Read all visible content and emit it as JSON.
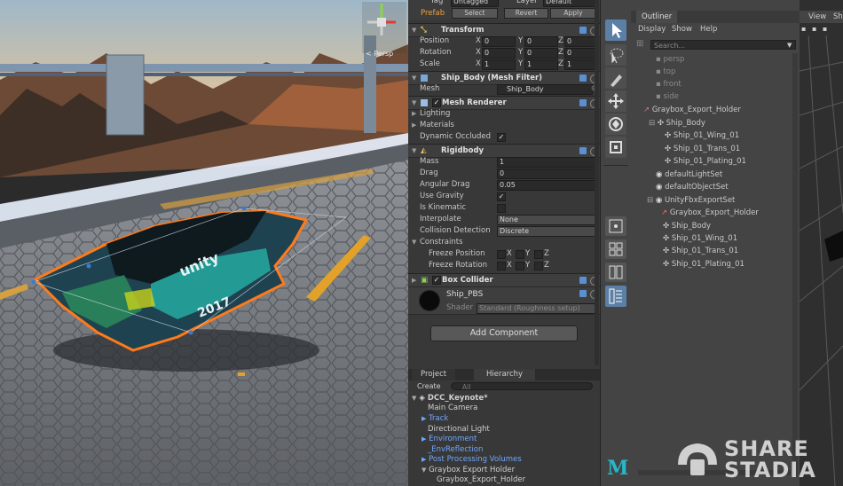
{
  "inspector": {
    "top": {
      "tag_label": "Tag",
      "tag_value": "Untagged",
      "layer_label": "Layer",
      "layer_value": "Default",
      "prefab_label": "Prefab",
      "select": "Select",
      "revert": "Revert",
      "apply": "Apply"
    },
    "transform": {
      "title": "Transform",
      "position": "Position",
      "rotation": "Rotation",
      "scale": "Scale",
      "x": "X",
      "y": "Y",
      "z": "Z",
      "pos": [
        "0",
        "0",
        "0"
      ],
      "rot": [
        "0",
        "0",
        "0"
      ],
      "scl": [
        "1",
        "1",
        "1"
      ]
    },
    "mesh_filter": {
      "title": "Ship_Body (Mesh Filter)",
      "mesh_label": "Mesh",
      "mesh_value": "Ship_Body"
    },
    "mesh_renderer": {
      "title": "Mesh Renderer",
      "lighting": "Lighting",
      "materials": "Materials",
      "dynamic_occluded": "Dynamic Occluded",
      "dynamic_occluded_check": "✓"
    },
    "rigidbody": {
      "title": "Rigidbody",
      "mass_label": "Mass",
      "mass": "1",
      "drag_label": "Drag",
      "drag": "0",
      "angular_drag_label": "Angular Drag",
      "angular_drag": "0.05",
      "use_gravity": "Use Gravity",
      "use_gravity_check": "✓",
      "is_kinematic": "Is Kinematic",
      "interpolate_label": "Interpolate",
      "interpolate": "None",
      "collision_label": "Collision Detection",
      "collision": "Discrete",
      "constraints": "Constraints",
      "freeze_position": "Freeze Position",
      "freeze_rotation": "Freeze Rotation",
      "x": "X",
      "y": "Y",
      "z": "Z"
    },
    "box_collider": {
      "title": "Box Collider"
    },
    "material": {
      "name": "Ship_PBS",
      "shader_label": "Shader",
      "shader": "Standard (Roughness setup)"
    },
    "add_component": "Add Component"
  },
  "hierarchy": {
    "tabs": [
      "Project",
      "Hierarchy"
    ],
    "create": "Create",
    "search_placeholder": "All",
    "scene": "DCC_Keynote*",
    "items": [
      "Main Camera",
      "Track",
      "Directional Light",
      "Environment",
      "_EnvReflection",
      "Post Processing Volumes",
      "Graybox Export Holder",
      "Graybox_Export_Holder"
    ]
  },
  "outliner": {
    "title": "Outliner",
    "menu": [
      "Display",
      "Show",
      "Help"
    ],
    "search_placeholder": "Search...",
    "items": [
      "persp",
      "top",
      "front",
      "side",
      "Graybox_Export_Holder",
      "Ship_Body",
      "Ship_01_Wing_01",
      "Ship_01_Trans_01",
      "Ship_01_Plating_01",
      "defaultLightSet",
      "defaultObjectSet",
      "UnityFbxExportSet",
      "Graybox_Export_Holder",
      "Ship_Body",
      "Ship_01_Wing_01",
      "Ship_01_Trans_01",
      "Ship_01_Plating_01"
    ]
  },
  "viewport": {
    "view_menu": "View",
    "shading_menu": "Sh"
  },
  "scene_view": {
    "persp_label": "< Persp",
    "decal_year": "2017",
    "decal_brand": "unity"
  },
  "watermark": {
    "line1": "SHARE",
    "line2": "STADIA"
  },
  "maya_logo": "M",
  "colors": {
    "accent": "#5b8fd3",
    "selection_orange": "#ff7a1a",
    "hierarchy_blue": "#6fa8ff"
  }
}
